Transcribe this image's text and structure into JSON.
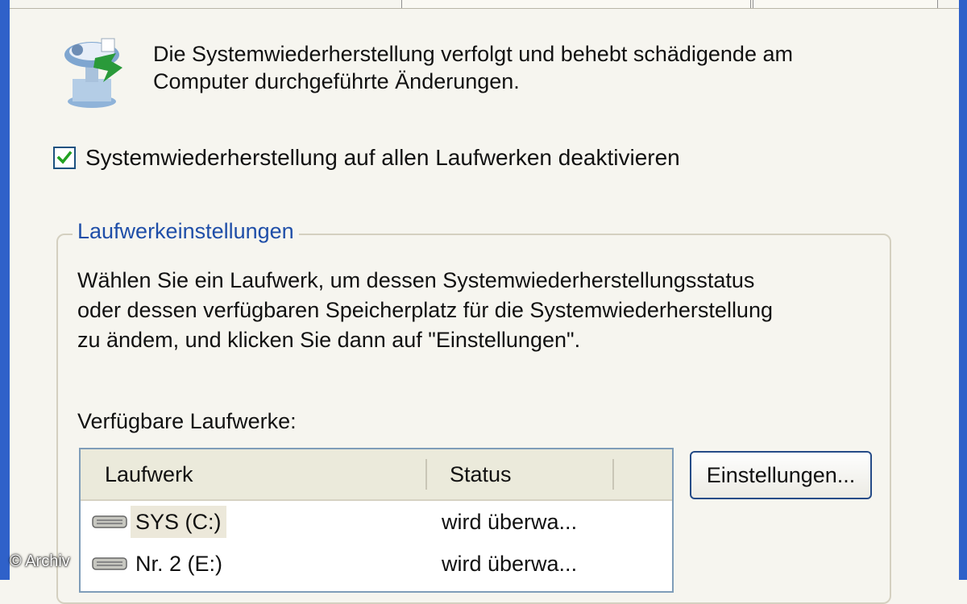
{
  "intro": {
    "line1": "Die Systemwiederherstellung verfolgt und behebt schädigende am",
    "line2": "Computer durchgeführte Änderungen."
  },
  "disable_checkbox": {
    "label": "Systemwiederherstellung auf allen Laufwerken deaktivieren",
    "checked": true
  },
  "drive_settings": {
    "title": "Laufwerkeinstellungen",
    "desc_line1": "Wählen Sie ein Laufwerk, um dessen Systemwiederherstellungsstatus",
    "desc_line2": "oder dessen verfügbaren Speicherplatz für die Systemwiederherstellung",
    "desc_line3": "zu ändem, und klicken Sie dann auf \"Einstellungen\".",
    "available_label": "Verfügbare Laufwerke:",
    "columns": {
      "drive": "Laufwerk",
      "status": "Status"
    },
    "drives": [
      {
        "name": "SYS (C:)",
        "status": "wird überwa..."
      },
      {
        "name": "Nr. 2 (E:)",
        "status": "wird überwa..."
      }
    ],
    "settings_button": "Einstellungen..."
  },
  "watermark": "© Archiv",
  "colors": {
    "window_border": "#2f61c9",
    "group_title": "#1f4ea8",
    "check_green": "#21a121"
  },
  "icons": {
    "system_restore": "system-restore-icon",
    "drive": "hard-drive-icon",
    "checkmark": "checkmark-icon"
  }
}
